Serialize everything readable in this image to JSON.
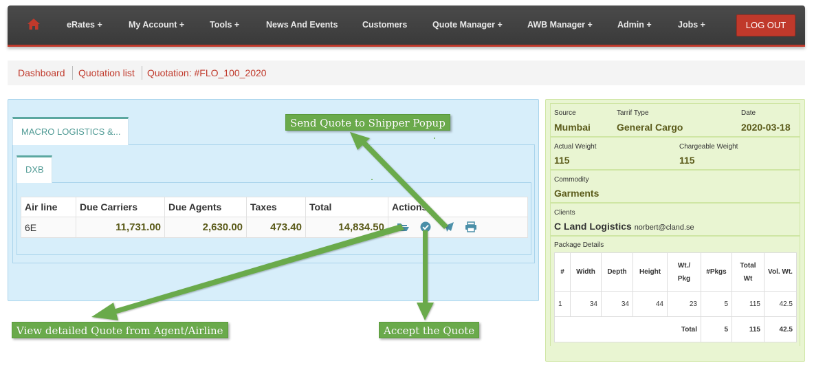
{
  "nav": {
    "items": [
      "eRates +",
      "My Account +",
      "Tools +",
      "News And Events",
      "Customers",
      "Quote Manager +",
      "AWB Manager +",
      "Admin +",
      "Jobs +"
    ],
    "logout_label": "LOG OUT",
    "accent_color": "#c0392b"
  },
  "breadcrumb": [
    "Dashboard",
    "Quotation list",
    "Quotation: #FLO_100_2020"
  ],
  "quote": {
    "agent_tab": "MACRO LOGISTICS &...",
    "station_tab": "DXB",
    "columns": [
      "Air line",
      "Due Carriers",
      "Due Agents",
      "Taxes",
      "Total",
      "Actions"
    ],
    "rows": [
      {
        "airline": "6E",
        "due_carriers": "11,731.00",
        "due_agents": "2,630.00",
        "taxes": "473.40",
        "total": "14,834.50"
      }
    ],
    "action_icons": [
      "folder-open-icon",
      "check-circle-icon",
      "paper-plane-icon",
      "print-icon"
    ]
  },
  "details": {
    "source_label": "Source",
    "source": "Mumbai",
    "tarrif_label": "Tarrif Type",
    "tarrif": "General Cargo",
    "date_label": "Date",
    "date": "2020-03-18",
    "actual_weight_label": "Actual Weight",
    "actual_weight": "115",
    "chargeable_weight_label": "Chargeable Weight",
    "chargeable_weight": "115",
    "commodity_label": "Commodity",
    "commodity": "Garments",
    "clients_label": "Clients",
    "client_name": "C Land Logistics",
    "client_email": "norbert@cland.se",
    "package_label": "Package Details",
    "package_columns": [
      "#",
      "Width",
      "Depth",
      "Height",
      "Wt./ Pkg",
      "#Pkgs",
      "Total Wt",
      "Vol. Wt."
    ],
    "package_rows": [
      [
        "1",
        "34",
        "34",
        "44",
        "23",
        "5",
        "115",
        "42.5"
      ]
    ],
    "total_label": "Total",
    "total_pkgs": "5",
    "total_wt": "115",
    "total_vol": "42.5"
  },
  "callouts": {
    "send": "Send Quote to Shipper Popup",
    "view": "View detailed Quote from Agent/Airline",
    "accept": "Accept the Quote",
    "color": "#6aaa4b"
  }
}
